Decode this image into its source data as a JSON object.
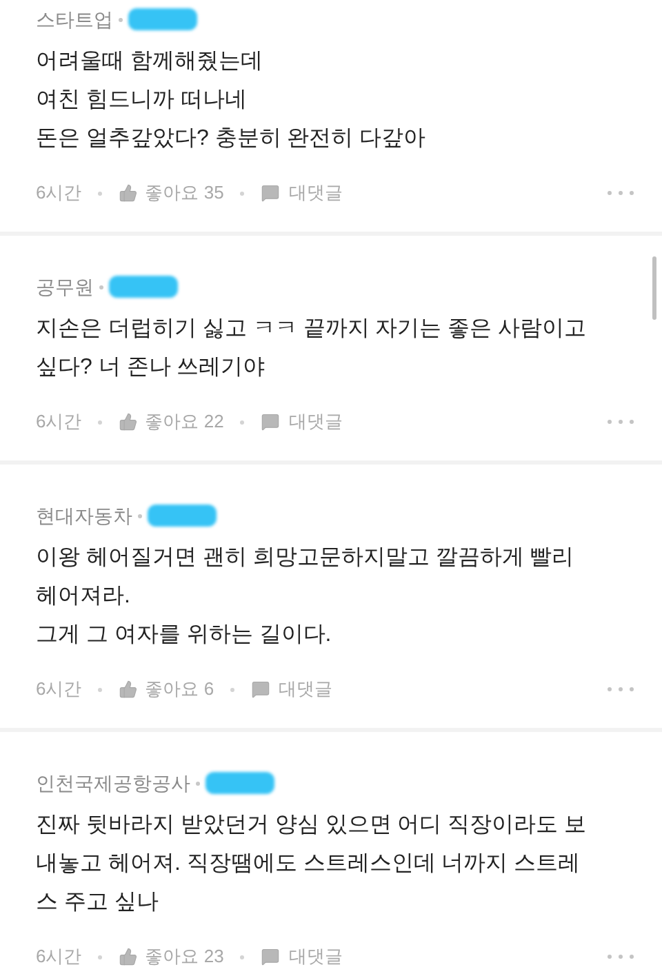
{
  "comments": [
    {
      "company": "스타트업",
      "body": "어려울때 함께해줬는데\n여친 힘드니까 떠나네\n돈은 얼추갚았다? 충분히 완전히 다갚아",
      "time": "6시간",
      "likes": "좋아요 35",
      "reply": "대댓글"
    },
    {
      "company": "공무원",
      "body": "지손은 더럽히기 싫고 ㅋㅋ 끝까지 자기는 좋은 사람이고\n싶다? 너 존나 쓰레기야",
      "time": "6시간",
      "likes": "좋아요 22",
      "reply": "대댓글"
    },
    {
      "company": "현대자동차",
      "body": "이왕 헤어질거면 괜히 희망고문하지말고 깔끔하게 빨리\n헤어져라.\n그게 그 여자를 위하는 길이다.",
      "time": "6시간",
      "likes": "좋아요 6",
      "reply": "대댓글"
    },
    {
      "company": "인천국제공항공사",
      "body": "진짜 뒷바라지 받았던거 양심 있으면 어디 직장이라도 보\n내놓고 헤어져. 직장땜에도 스트레스인데 너까지 스트레\n스 주고 싶나",
      "time": "6시간",
      "likes": "좋아요 23",
      "reply": "대댓글"
    }
  ]
}
